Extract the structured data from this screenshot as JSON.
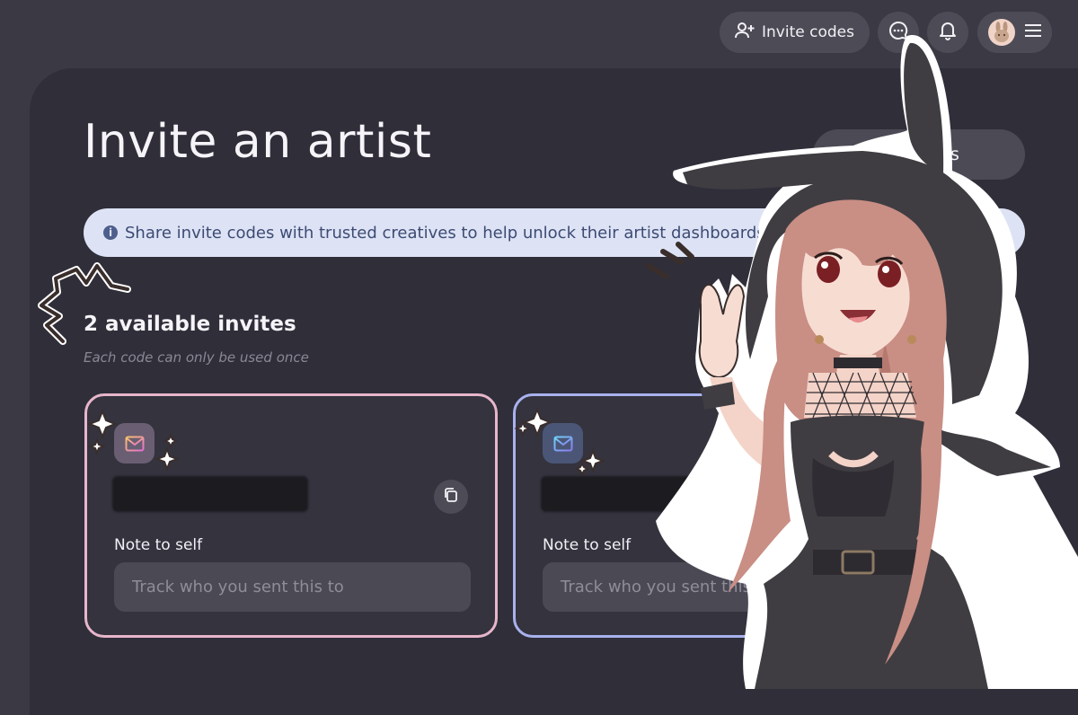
{
  "topbar": {
    "invite_codes_label": "Invite codes",
    "icons": [
      "person-plus-icon",
      "chat-bubble-icon",
      "bell-icon",
      "bunny-avatar",
      "hamburger-menu-icon"
    ]
  },
  "main": {
    "title": "Invite an artist",
    "create_button_label": "codes",
    "banner_text": "Share invite codes with trusted creatives to help unlock their artist dashboards!",
    "available_title": "2 available invites",
    "available_subtitle": "Each code can only be used once"
  },
  "cards": [
    {
      "code": "",
      "note_label": "Note to self",
      "note_placeholder": "Track who you sent this to",
      "accent": "#e7b6cb"
    },
    {
      "code": "",
      "note_label": "Note to self",
      "note_placeholder": "Track who you sent this to",
      "accent": "#a9b2ee"
    }
  ],
  "colors": {
    "background": "#3a3944",
    "panel": "#2f2e39",
    "banner": "#dde3f5",
    "banner_text": "#3d4b73"
  }
}
